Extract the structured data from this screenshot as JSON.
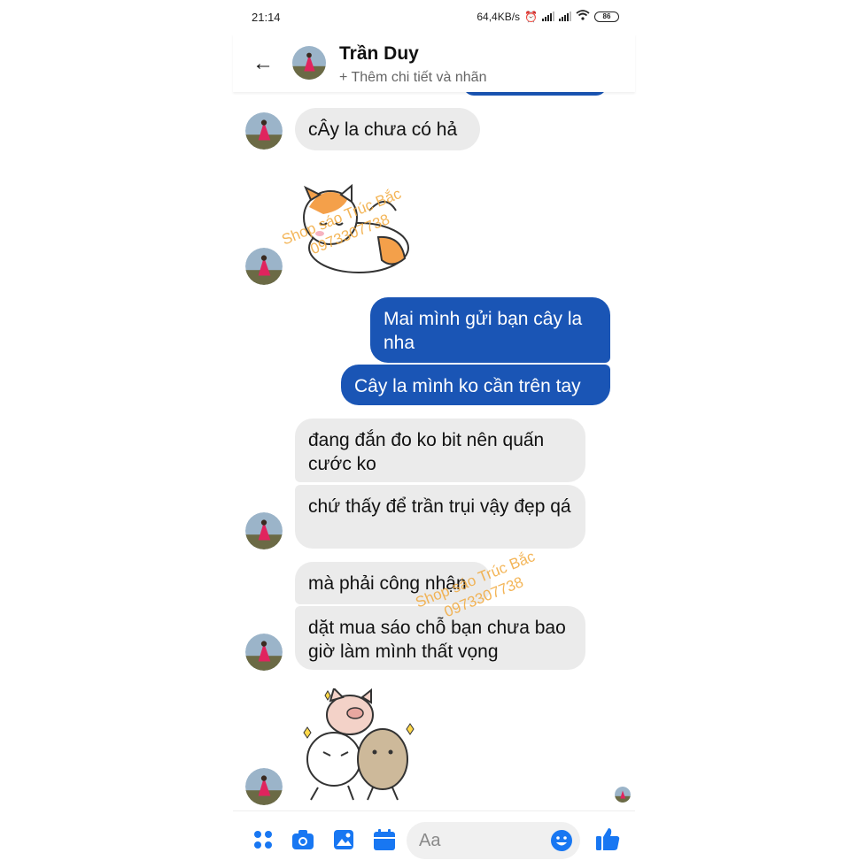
{
  "status": {
    "time": "21:14",
    "network": "64,4KB/s",
    "battery": "86"
  },
  "header": {
    "name": "Trần Duy",
    "subtitle": "+ Thêm chi tiết và nhãn"
  },
  "messages": [
    {
      "text": "cÂy la chưa có hả"
    },
    {
      "text": "Mai mình gửi bạn cây la nha"
    },
    {
      "text": "Cây la mình ko cần trên tay"
    },
    {
      "text": "đang đắn đo ko bit nên quấn cước ko"
    },
    {
      "text": "chứ thấy để trần trụi vậy đẹp qá"
    },
    {
      "text": "mà phải công nhận"
    },
    {
      "text": "dặt mua sáo chỗ bạn chưa bao giờ làm mình thất vọng"
    }
  ],
  "watermark": {
    "line1": "Shop sáo Trúc Bắc",
    "line2": "0973307738"
  },
  "composer": {
    "placeholder": "Aa"
  },
  "icons": [
    "back-arrow-icon",
    "menu-dots-icon",
    "camera-icon",
    "gallery-icon",
    "calendar-icon",
    "emoji-icon",
    "like-icon"
  ],
  "colors": {
    "outgoing": "#1a55b5",
    "incoming": "#ebebeb",
    "accent": "#1877f2",
    "watermark": "#f2a93b"
  }
}
